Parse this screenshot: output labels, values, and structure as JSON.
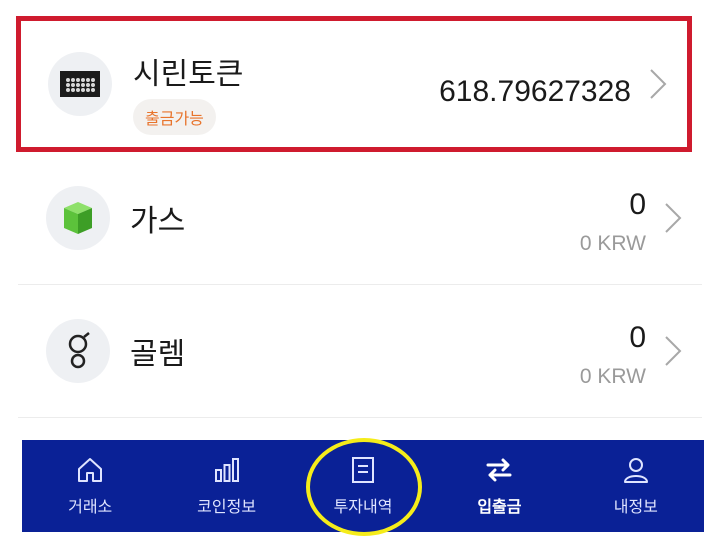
{
  "coins": [
    {
      "name": "시린토큰",
      "badge": "출금가능",
      "amount": "618.79627328",
      "krw": "",
      "icon": "sirin-token-icon"
    },
    {
      "name": "가스",
      "badge": "",
      "amount": "0",
      "krw": "0 KRW",
      "icon": "gas-icon"
    },
    {
      "name": "골렘",
      "badge": "",
      "amount": "0",
      "krw": "0 KRW",
      "icon": "golem-icon"
    }
  ],
  "colors": {
    "highlight_red": "#cf1b2e",
    "highlight_yellow": "#f5ec1a",
    "tabbar_bg": "#0a2196",
    "badge_text": "#e8742c",
    "gas_green": "#5cc23b"
  },
  "tabbar": {
    "items": [
      {
        "label": "거래소",
        "icon": "home-icon"
      },
      {
        "label": "코인정보",
        "icon": "bar-chart-icon"
      },
      {
        "label": "투자내역",
        "icon": "document-icon"
      },
      {
        "label": "입출금",
        "icon": "transfer-arrows-icon",
        "active": true
      },
      {
        "label": "내정보",
        "icon": "user-icon"
      }
    ]
  }
}
